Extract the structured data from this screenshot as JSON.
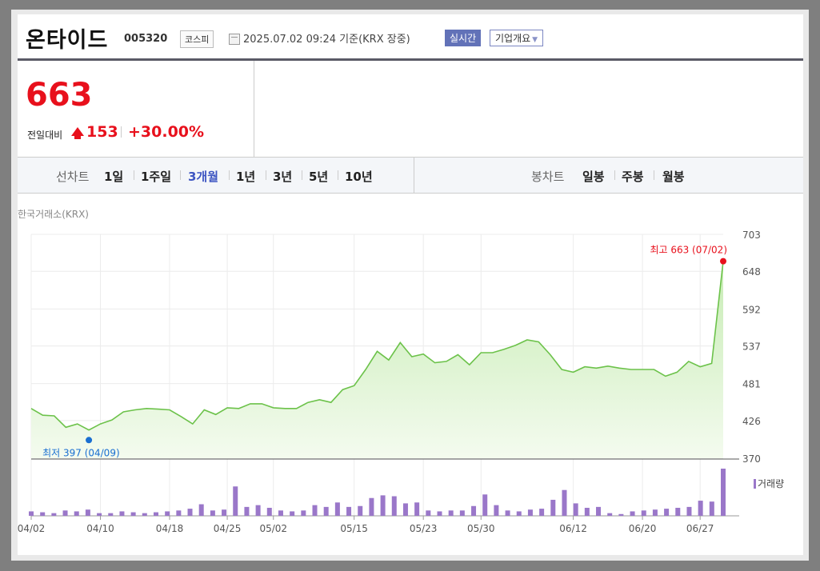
{
  "header": {
    "company": "온타이드",
    "code": "005320",
    "market": "코스피",
    "datetime": "2025.07.02 09:24 기준(KRX 장중)",
    "realtime_label": "실시간",
    "corp_label": "기업개요"
  },
  "price": {
    "value": "663",
    "change_label": "전일대비",
    "change": "153",
    "rate": "+30.00%"
  },
  "tabs": {
    "line_label": "선차트",
    "line": [
      "1일",
      "1주일",
      "3개월",
      "1년",
      "3년",
      "5년",
      "10년"
    ],
    "active": "3개월",
    "candle_label": "봉차트",
    "candle": [
      "일봉",
      "주봉",
      "월봉"
    ]
  },
  "colors": {
    "up": "#e8101c",
    "active_tab": "#3d55c2",
    "line": "#6cc24a",
    "volume": "#9a77c9",
    "low_marker": "#1a6fd1"
  },
  "chart_data": {
    "type": "area",
    "source_label": "한국거래소(KRX)",
    "ylim": [
      370,
      703
    ],
    "yticks": [
      703,
      648,
      592,
      537,
      481,
      426,
      370
    ],
    "xticks": [
      "04/02",
      "04/10",
      "04/18",
      "04/25",
      "05/02",
      "05/15",
      "05/23",
      "05/30",
      "06/12",
      "06/20",
      "06/27"
    ],
    "xtick_index": [
      0,
      6,
      12,
      17,
      21,
      28,
      34,
      39,
      47,
      53,
      58
    ],
    "series": [
      {
        "values": [
          444,
          434,
          433,
          416,
          421,
          412,
          421,
          427,
          439,
          442,
          444,
          443,
          442,
          432,
          421,
          442,
          435,
          445,
          444,
          451,
          451,
          445,
          444,
          444,
          453,
          457,
          453,
          472,
          478,
          502,
          529,
          516,
          542,
          521,
          525,
          512,
          514,
          524,
          509,
          527,
          527,
          532,
          538,
          546,
          543,
          524,
          502,
          498,
          506,
          504,
          507,
          504,
          502,
          502,
          502,
          492,
          498,
          514,
          506,
          511,
          663
        ]
      }
    ],
    "annotations": {
      "high": {
        "label": "최고 663 (07/02)",
        "value": 663,
        "index": 60
      },
      "low": {
        "label": "최저 397 (04/09)",
        "value": 397,
        "index": 5
      }
    },
    "volume": {
      "label": "거래량",
      "values": [
        5,
        4,
        3,
        6,
        5,
        7,
        3,
        3,
        5,
        4,
        3,
        4,
        5,
        6,
        8,
        13,
        6,
        7,
        33,
        10,
        12,
        9,
        6,
        5,
        6,
        12,
        10,
        15,
        10,
        11,
        20,
        23,
        22,
        14,
        15,
        6,
        5,
        6,
        6,
        11,
        24,
        12,
        6,
        5,
        7,
        8,
        18,
        29,
        14,
        9,
        10,
        3,
        2,
        5,
        6,
        7,
        8,
        9,
        10,
        17,
        16,
        53
      ]
    }
  }
}
